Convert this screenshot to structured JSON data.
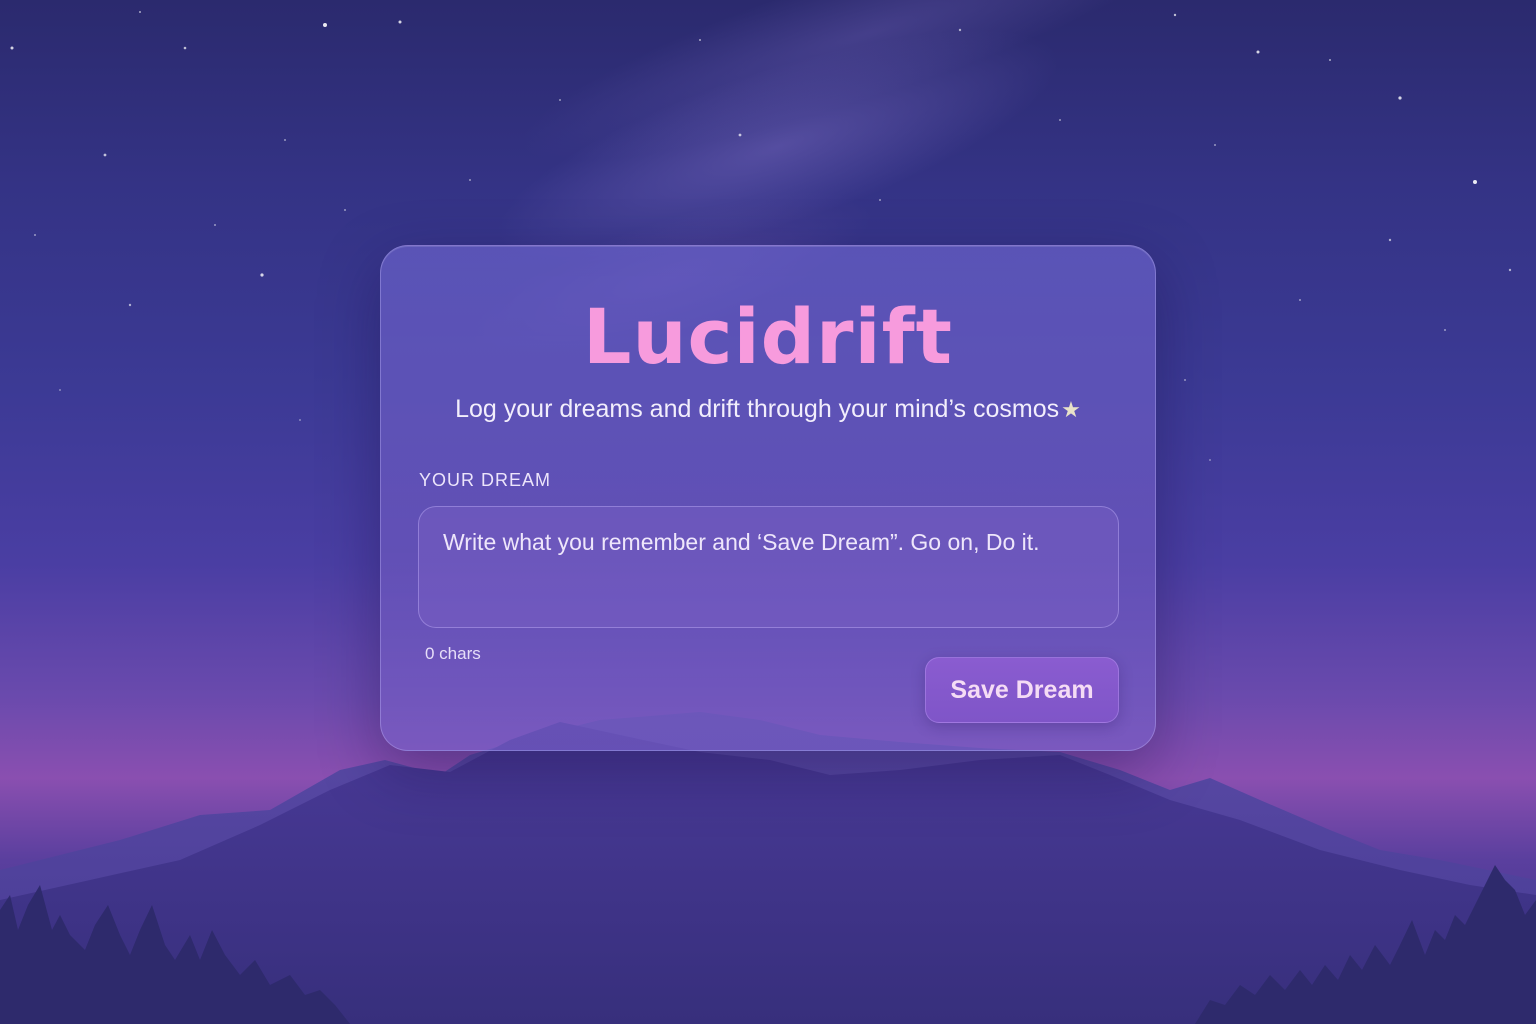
{
  "app": {
    "title": "Lucidrift",
    "subtitle": "Log your dreams and drift through your mind’s cosmos",
    "subtitle_icon": "star-icon"
  },
  "form": {
    "label": "YOUR DREAM",
    "placeholder": "Write what you remember and ‘Save Dream”. Go on, Do it.",
    "value": "",
    "char_count": "0 chars",
    "save_label": "Save Dream"
  },
  "colors": {
    "title": "#f79bdd",
    "button": "#8a5cd0",
    "sky_top": "#2b2a6e",
    "horizon_glow": "#8a4fb0"
  }
}
